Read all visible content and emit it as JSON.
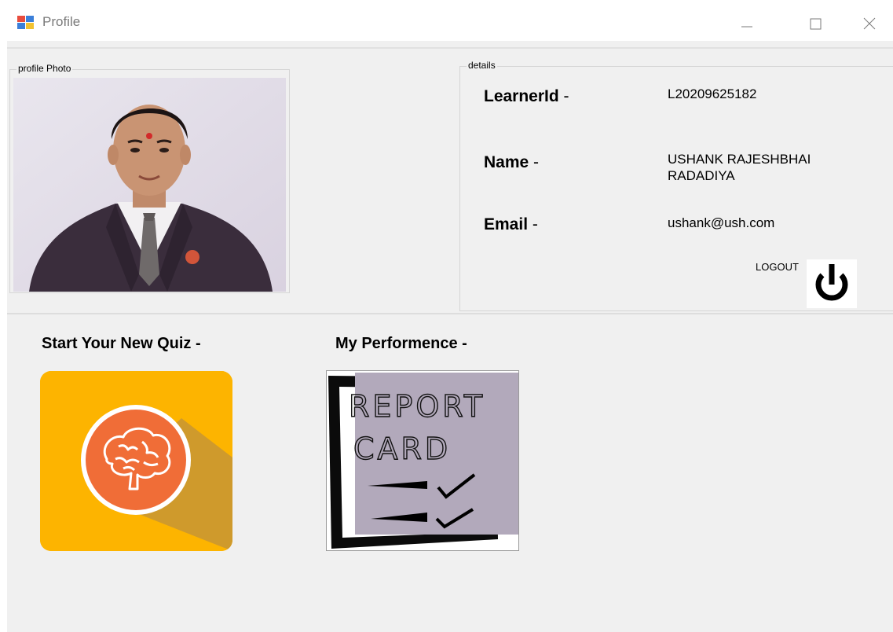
{
  "window": {
    "title": "Profile"
  },
  "photo_group": {
    "legend": "profile Photo"
  },
  "details_group": {
    "legend": "details",
    "learner_id_label": "LearnerId",
    "learner_id_value": "L20209625182",
    "name_label": "Name",
    "name_value_line1": "USHANK RAJESHBHAI",
    "name_value_line2": "RADADIYA",
    "email_label": "Email",
    "email_value": "ushank@ush.com",
    "dash": " -"
  },
  "logout": {
    "label": "LOGOUT",
    "icon": "power-icon"
  },
  "quiz_section": {
    "title": "Start Your New Quiz  -",
    "icon": "brain-icon",
    "color": "#fdb400"
  },
  "performance_section": {
    "title": "My Performence -",
    "card_line1": "REPORT",
    "card_line2": "CARD",
    "icon": "report-card-icon"
  },
  "colors": {
    "client_bg": "#f0f0f0",
    "quiz_bg": "#fdb400",
    "quiz_circle": "#f06d37",
    "report_paper": "#b2a9bb"
  }
}
